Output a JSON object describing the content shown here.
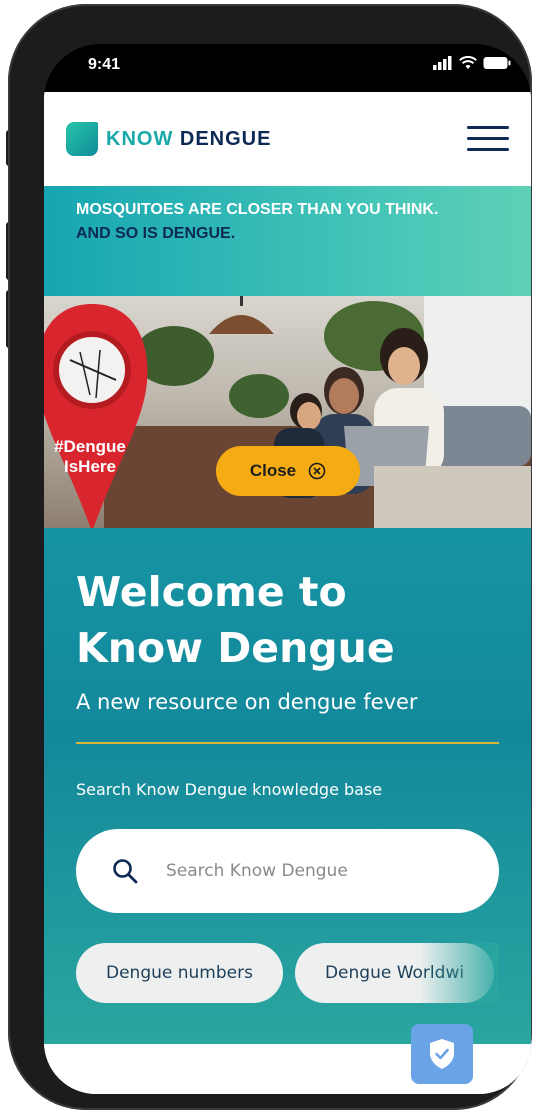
{
  "status_bar": {
    "time": "9:41"
  },
  "app": {
    "logo_part1": "KNOW",
    "logo_part2": "DENGUE"
  },
  "banner": {
    "line1": "MOSQUITOES ARE CLOSER THAN YOU THINK.",
    "line2": "AND SO IS DENGUE."
  },
  "hero": {
    "pin_hashtag_line1": "#Dengue",
    "pin_hashtag_line2": "IsHere",
    "close_label": "Close"
  },
  "welcome": {
    "title_line1": "Welcome to",
    "title_line2": "Know Dengue",
    "subtitle": "A new resource on dengue fever",
    "search_label": "Search Know Dengue knowledge base",
    "search_placeholder": "Search Know Dengue"
  },
  "chips": [
    "Dengue numbers",
    "Dengue Worldwi"
  ],
  "colors": {
    "teal": "#13889b",
    "accent": "#f5ac14",
    "navy": "#0d2a55"
  }
}
